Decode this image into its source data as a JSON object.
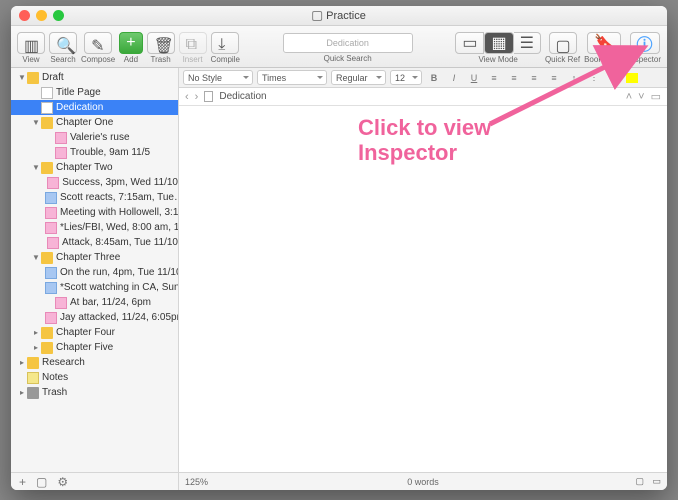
{
  "window": {
    "title": "Practice"
  },
  "toolbar": {
    "view": "View",
    "search": "Search",
    "compose": "Compose",
    "add": "Add",
    "trash": "Trash",
    "insert": "Insert",
    "compile": "Compile",
    "quick_search": "Quick Search",
    "qs_placeholder": "Dedication",
    "view_mode": "View Mode",
    "quick_ref": "Quick Ref",
    "bookmarks": "Bookmarks",
    "inspector": "Inspector"
  },
  "fmt": {
    "style": "No Style",
    "font": "Times",
    "weight": "Regular",
    "size": "12"
  },
  "nav": {
    "crumb": "Dedication"
  },
  "binder": {
    "items": [
      {
        "depth": 0,
        "icon": "folder",
        "label": "Draft",
        "disc": "▼"
      },
      {
        "depth": 1,
        "icon": "page",
        "label": "Title Page",
        "disc": ""
      },
      {
        "depth": 1,
        "icon": "page",
        "label": "Dedication",
        "disc": "",
        "sel": true
      },
      {
        "depth": 1,
        "icon": "folder",
        "label": "Chapter One",
        "disc": "▼"
      },
      {
        "depth": 2,
        "icon": "pagep",
        "label": "Valerie's ruse",
        "disc": ""
      },
      {
        "depth": 2,
        "icon": "pagep",
        "label": "Trouble, 9am 11/5",
        "disc": ""
      },
      {
        "depth": 1,
        "icon": "folder",
        "label": "Chapter Two",
        "disc": "▼"
      },
      {
        "depth": 2,
        "icon": "pagep",
        "label": "Success, 3pm, Wed 11/10",
        "disc": ""
      },
      {
        "depth": 2,
        "icon": "pageb",
        "label": "Scott reacts, 7:15am, Tue…",
        "disc": ""
      },
      {
        "depth": 2,
        "icon": "pagep",
        "label": "Meeting with Hollowell, 3:1…",
        "disc": ""
      },
      {
        "depth": 2,
        "icon": "pagep",
        "label": "*Lies/FBI, Wed, 8:00 am, 1…",
        "disc": ""
      },
      {
        "depth": 2,
        "icon": "pagep",
        "label": "Attack, 8:45am, Tue 11/10",
        "disc": ""
      },
      {
        "depth": 1,
        "icon": "folder",
        "label": "Chapter Three",
        "disc": "▼"
      },
      {
        "depth": 2,
        "icon": "pageb",
        "label": "On the run, 4pm, Tue 11/10",
        "disc": ""
      },
      {
        "depth": 2,
        "icon": "pageb",
        "label": "*Scott watching in CA, Sun…",
        "disc": ""
      },
      {
        "depth": 2,
        "icon": "pagep",
        "label": "At bar, 11/24, 6pm",
        "disc": ""
      },
      {
        "depth": 2,
        "icon": "pagep",
        "label": "Jay attacked, 11/24, 6:05pm",
        "disc": ""
      },
      {
        "depth": 1,
        "icon": "folder",
        "label": "Chapter Four",
        "disc": "▸"
      },
      {
        "depth": 1,
        "icon": "folder",
        "label": "Chapter Five",
        "disc": "▸"
      },
      {
        "depth": 0,
        "icon": "folder",
        "label": "Research",
        "disc": "▸"
      },
      {
        "depth": 0,
        "icon": "pagey",
        "label": "Notes",
        "disc": ""
      },
      {
        "depth": 0,
        "icon": "trash",
        "label": "Trash",
        "disc": "▸"
      }
    ]
  },
  "status": {
    "zoom": "125%",
    "words": "0 words"
  },
  "annotation": {
    "line1": "Click to view",
    "line2": "Inspector"
  },
  "colors": {
    "accent": "#f0639c",
    "selection": "#3b82f6"
  }
}
